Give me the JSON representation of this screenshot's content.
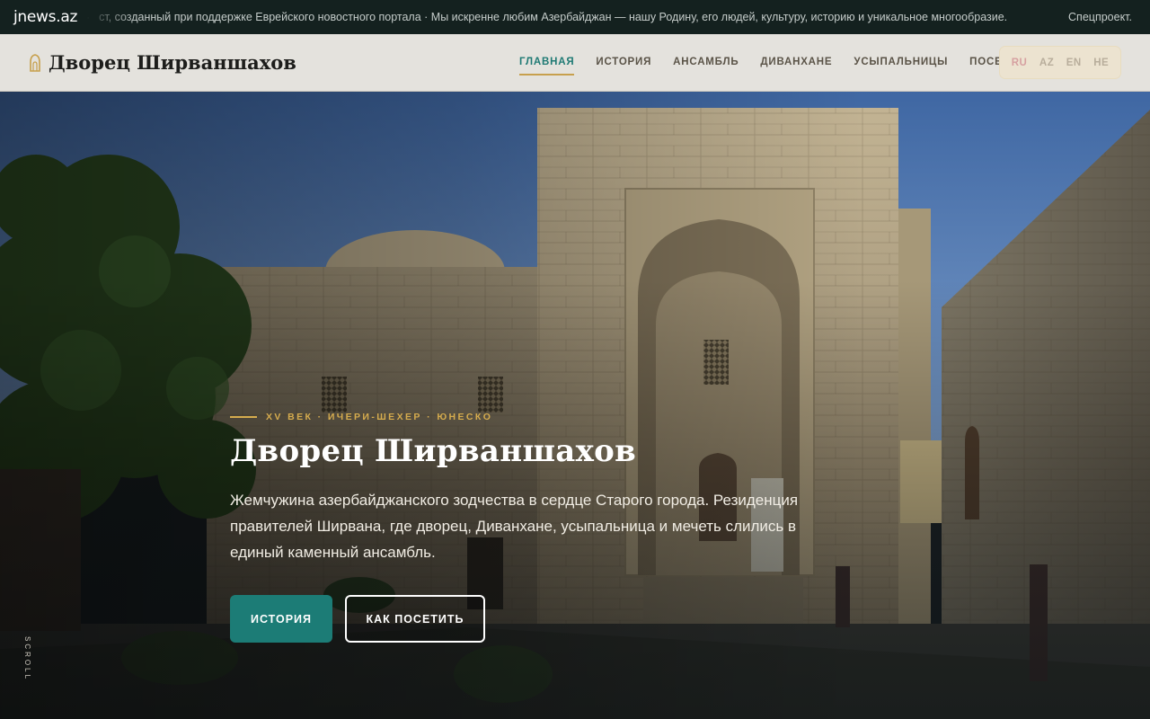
{
  "topbar": {
    "logo": "jnews.az",
    "separator": "·",
    "ticker": "ст, созданный при поддержке Еврейского новостного портала · Мы искренне любим Азербайджан — нашу Родину, его людей, культуру, историю и уникальное многообразие.",
    "special": "Спецпроект."
  },
  "header": {
    "brand": "Дворец Ширваншахов",
    "nav": [
      {
        "label": "ГЛАВНАЯ",
        "active": true
      },
      {
        "label": "ИСТОРИЯ",
        "active": false
      },
      {
        "label": "АНСАМБЛЬ",
        "active": false
      },
      {
        "label": "ДИВАНХАНЕ",
        "active": false
      },
      {
        "label": "УСЫПАЛЬНИЦЫ",
        "active": false
      },
      {
        "label": "ПОСЕЩЕНИЕ",
        "active": false
      }
    ],
    "languages": [
      {
        "label": "RU",
        "active": true
      },
      {
        "label": "AZ",
        "active": false
      },
      {
        "label": "EN",
        "active": false
      },
      {
        "label": "HE",
        "active": false
      }
    ]
  },
  "hero": {
    "eyebrow": "XV ВЕК · ИЧЕРИ-ШЕХЕР · ЮНЕСКО",
    "title": "Дворец Ширваншахов",
    "lead": "Жемчужина азербайджанского зодчества в сердце Старого города. Резиденция правителей Ширвана, где дворец, Диванхане, усыпальница и мечеть слились в единый каменный ансамбль.",
    "primary_button": "ИСТОРИЯ",
    "secondary_button": "КАК ПОСЕТИТЬ",
    "scroll_label": "SCROLL"
  },
  "colors": {
    "accent": "#1c7c76",
    "gold": "#d6ac4e",
    "header_bg": "#e4e2dd",
    "topbar_bg": "#14211f"
  }
}
